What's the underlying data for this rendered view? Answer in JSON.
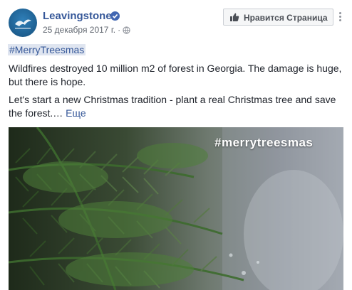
{
  "post": {
    "page_name": "Leavingstone",
    "date": "25 декабря 2017 г.",
    "meta_separator": "·",
    "like_button": "Нравится Страница",
    "hashtag": "#MerryTreesmas",
    "paragraph1": "Wildfires destroyed 10 million m2 of forest in Georgia. The damage is huge, but there is hope.",
    "paragraph2": "Let's start a new Christmas tradition - plant a real Christmas tree and save the forest.…",
    "see_more": "Еще",
    "photo_tag": "#merrytreesmas"
  },
  "colors": {
    "link": "#365899",
    "verified": "#4267b2",
    "hashtag_bg": "#dfe5f0"
  },
  "icons": {
    "verified": "check-badge-icon",
    "privacy": "globe-icon",
    "like": "thumb-up-icon",
    "more": "more-dots-icon"
  }
}
